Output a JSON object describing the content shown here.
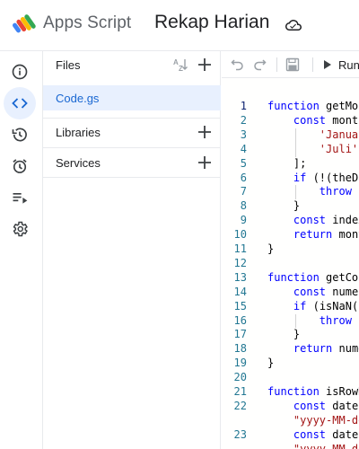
{
  "header": {
    "product_name": "Apps Script",
    "project_name": "Rekap Harian"
  },
  "rail": {
    "items": [
      {
        "name": "overview",
        "icon": "info-icon",
        "active": false
      },
      {
        "name": "editor",
        "icon": "code-icon",
        "active": true
      },
      {
        "name": "triggers-history",
        "icon": "history-icon",
        "active": false
      },
      {
        "name": "triggers",
        "icon": "alarm-icon",
        "active": false
      },
      {
        "name": "executions",
        "icon": "playlist-icon",
        "active": false
      },
      {
        "name": "settings",
        "icon": "gear-icon",
        "active": false
      }
    ]
  },
  "files_panel": {
    "title": "Files",
    "files": [
      "Code.gs"
    ],
    "sections": [
      "Libraries",
      "Services"
    ]
  },
  "toolbar": {
    "run_label": "Run"
  },
  "editor": {
    "line_numbers": [
      "1",
      "2",
      "3",
      "4",
      "5",
      "6",
      "7",
      "8",
      "9",
      "10",
      "11",
      "12",
      "13",
      "14",
      "15",
      "16",
      "17",
      "18",
      "19",
      "20",
      "21",
      "22",
      "",
      "23",
      ""
    ],
    "lines": [
      "function getMon",
      "    const month",
      "        'Januar",
      "        'Juli',",
      "    ];",
      "    if (!(theDa",
      "        throw n",
      "    }",
      "    const index",
      "    return mont",
      "}",
      "",
      "function getCol",
      "    const numer",
      "    if (isNaN(n",
      "        throw n",
      "    }",
      "    return nume",
      "}",
      "",
      "function isRowD",
      "    const dateF",
      "    \"yyyy-MM-dd",
      "    const dateF",
      "    \"yyyy-MM-dd"
    ]
  },
  "colors": {
    "accent": "#1967d2",
    "active_bg": "#e8f0fe",
    "keyword": "#0000ff",
    "string": "#a31515",
    "line_number": "#237893"
  }
}
